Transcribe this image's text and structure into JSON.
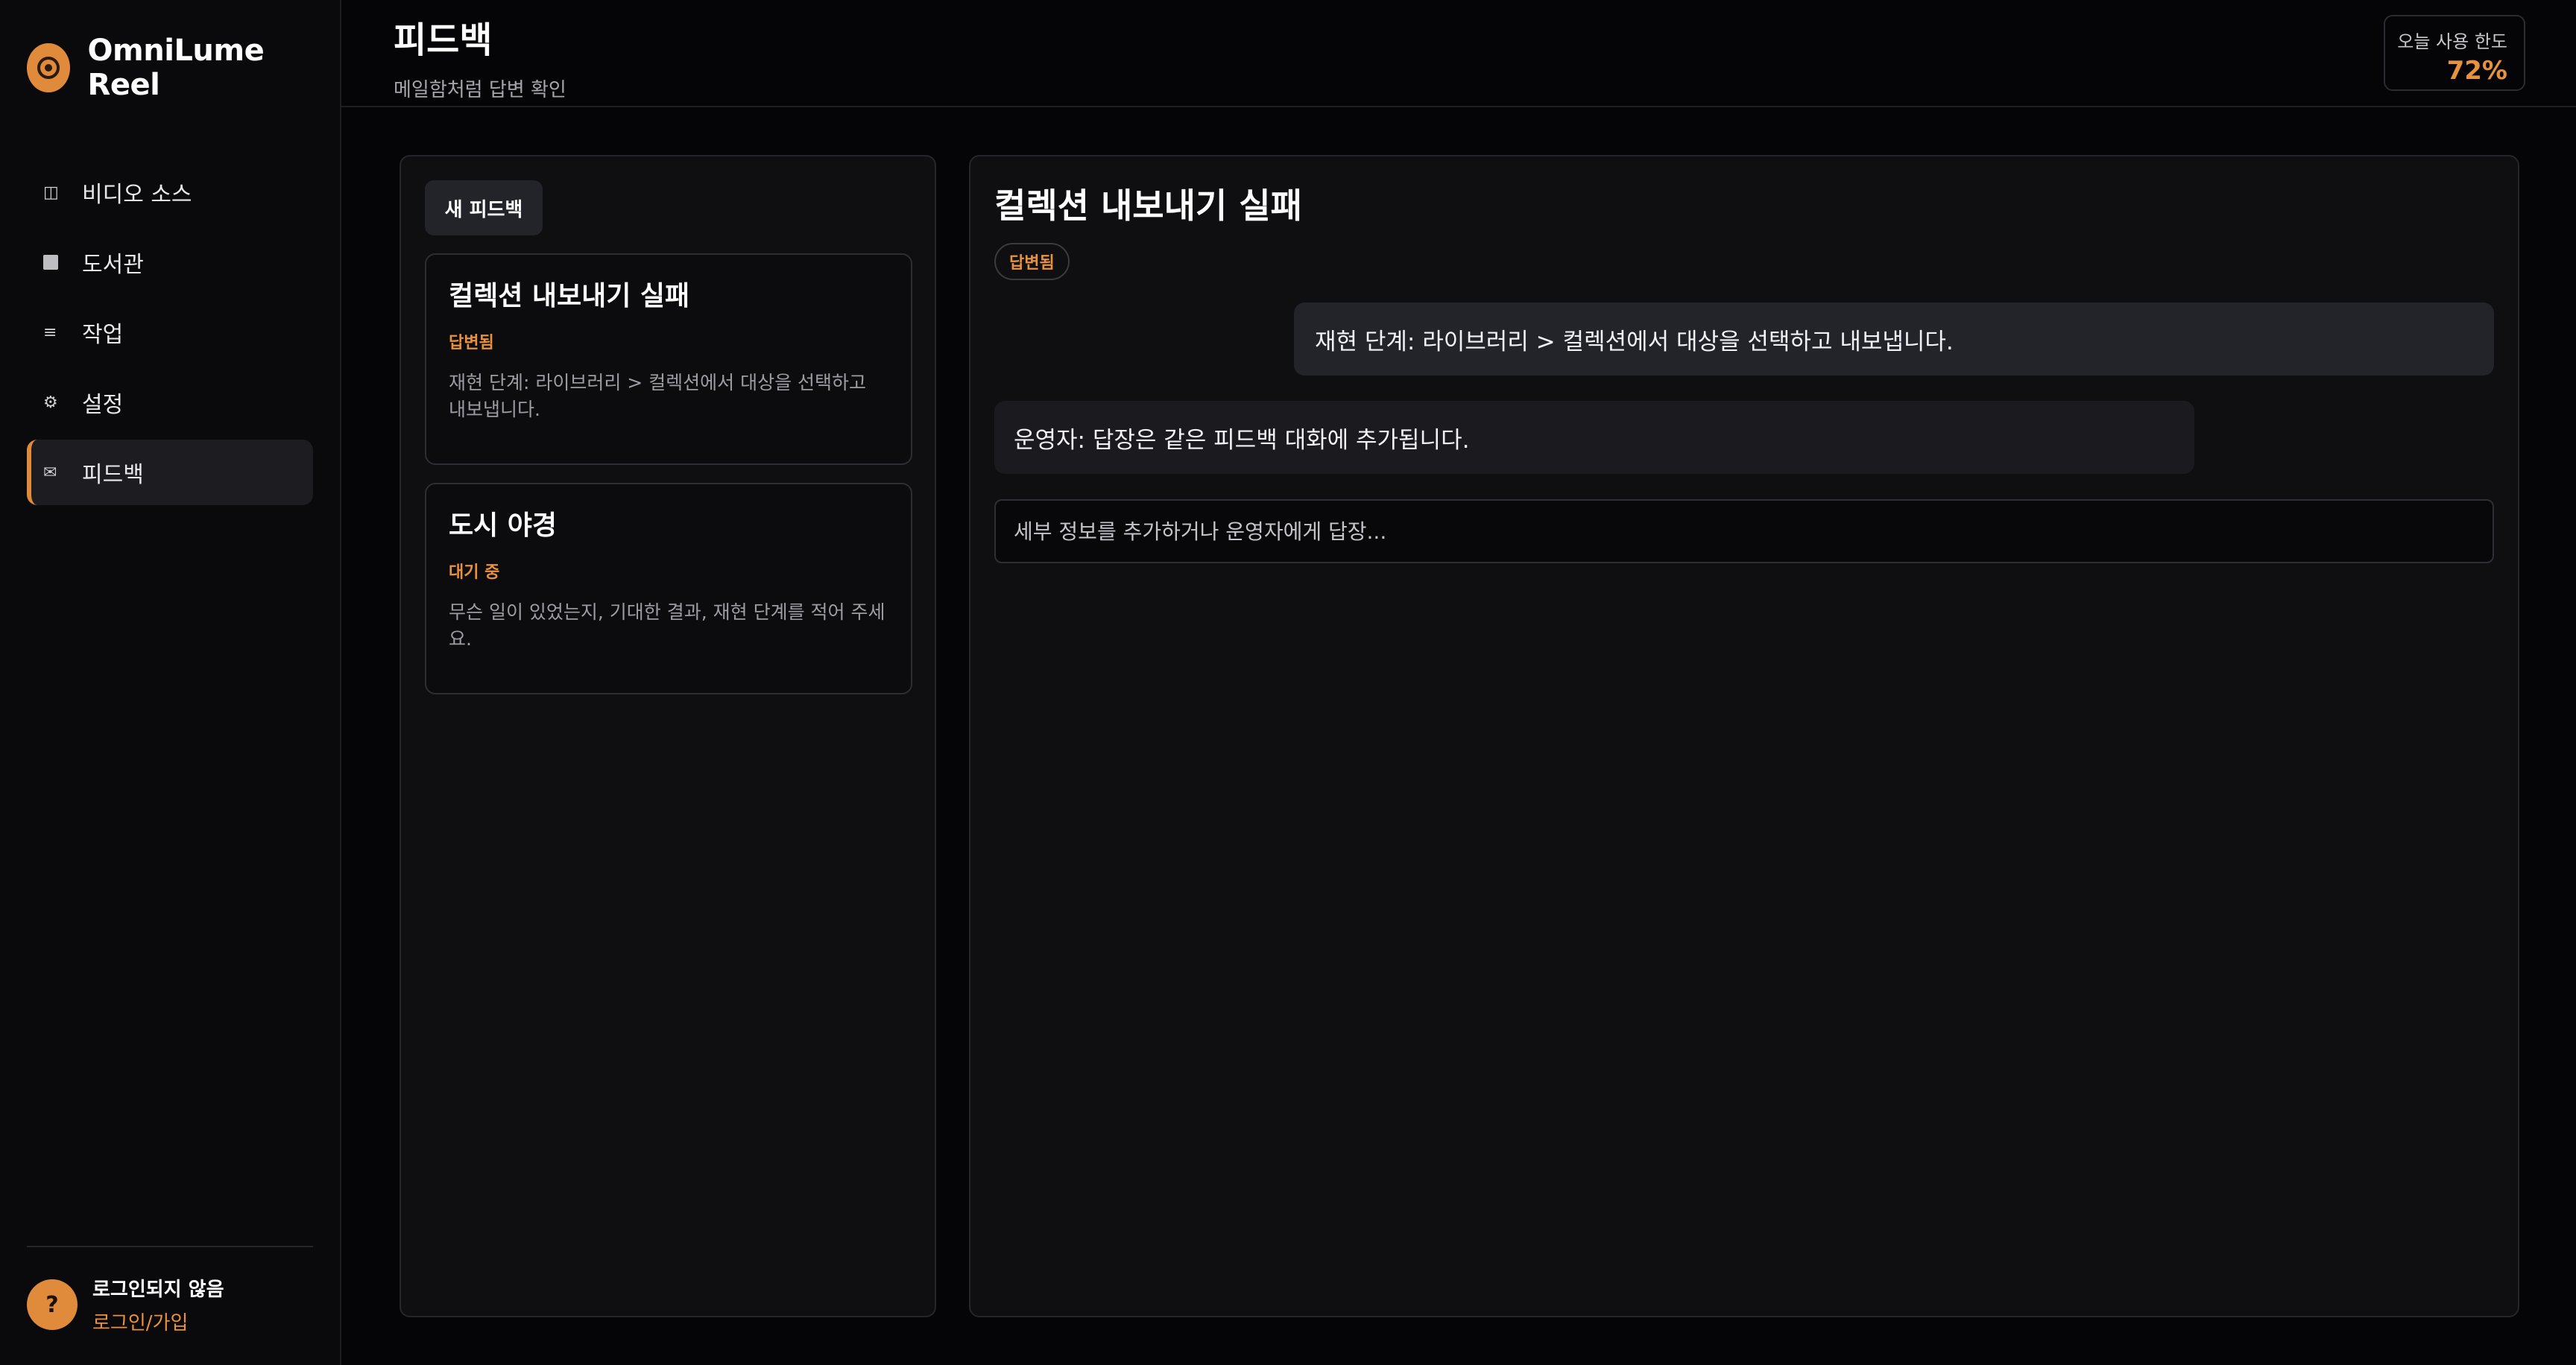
{
  "app": {
    "name": "OmniLume Reel",
    "accent_color": "#e08a3c"
  },
  "sidebar": {
    "items": [
      {
        "label": "비디오 소스",
        "icon": "columns-icon"
      },
      {
        "label": "도서관",
        "icon": "square-icon"
      },
      {
        "label": "작업",
        "icon": "list-icon"
      },
      {
        "label": "설정",
        "icon": "gear-icon"
      },
      {
        "label": "피드백",
        "icon": "envelope-icon",
        "active": true
      }
    ],
    "footer": {
      "avatar": "?",
      "status": "로그인되지 않음",
      "login_link": "로그인/가입"
    }
  },
  "header": {
    "title": "피드백",
    "subtitle": "메일함처럼 답변 확인",
    "usage": {
      "label": "오늘 사용 한도",
      "value": "72%"
    }
  },
  "list": {
    "new_button": "새 피드백",
    "tickets": [
      {
        "title": "컬렉션 내보내기 실패",
        "status": "답변됨",
        "excerpt": "재현 단계: 라이브러리 > 컬렉션에서 대상을 선택하고 내보냅니다."
      },
      {
        "title": "도시 야경",
        "status": "대기 중",
        "excerpt": "무슨 일이 있었는지, 기대한 결과, 재현 단계를 적어 주세요."
      }
    ]
  },
  "conversation": {
    "title": "컬렉션 내보내기 실패",
    "status_badge": "답변됨",
    "messages": [
      {
        "from": "user",
        "text": "재현 단계: 라이브러리 > 컬렉션에서 대상을 선택하고 내보냅니다."
      },
      {
        "from": "operator",
        "text": "운영자: 답장은 같은 피드백 대화에 추가됩니다."
      }
    ],
    "reply_placeholder": "세부 정보를 추가하거나 운영자에게 답장..."
  }
}
